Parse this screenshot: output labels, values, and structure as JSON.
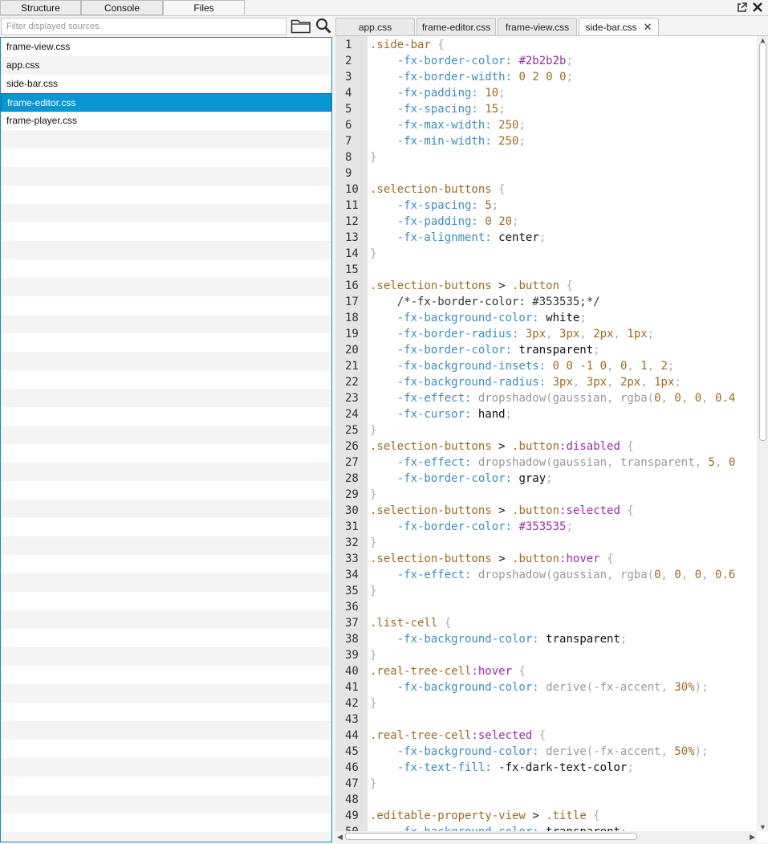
{
  "top_tabs": [
    {
      "label": "Structure",
      "active": false
    },
    {
      "label": "Console",
      "active": false
    },
    {
      "label": "Files",
      "active": true
    }
  ],
  "window_icons": [
    "external-link-icon",
    "close-icon"
  ],
  "filter": {
    "placeholder": "Filter displayed sources.",
    "value": ""
  },
  "file_list": [
    {
      "name": "frame-view.css",
      "selected": false
    },
    {
      "name": "app.css",
      "selected": false
    },
    {
      "name": "side-bar.css",
      "selected": false
    },
    {
      "name": "frame-editor.css",
      "selected": true
    },
    {
      "name": "frame-player.css",
      "selected": false
    }
  ],
  "editor_tabs": [
    {
      "label": "app.css",
      "active": false
    },
    {
      "label": "frame-editor.css",
      "active": false
    },
    {
      "label": "frame-view.css",
      "active": false
    },
    {
      "label": "side-bar.css",
      "active": true,
      "closable": true
    }
  ],
  "code_lines": [
    ".side-bar {",
    "    -fx-border-color: #2b2b2b;",
    "    -fx-border-width: 0 2 0 0;",
    "    -fx-padding: 10;",
    "    -fx-spacing: 15;",
    "    -fx-max-width: 250;",
    "    -fx-min-width: 250;",
    "}",
    "",
    ".selection-buttons {",
    "    -fx-spacing: 5;",
    "    -fx-padding: 0 20;",
    "    -fx-alignment: center;",
    "}",
    "",
    ".selection-buttons > .button {",
    "    /*-fx-border-color: #353535;*/",
    "    -fx-background-color: white;",
    "    -fx-border-radius: 3px, 3px, 2px, 1px;",
    "    -fx-border-color: transparent;",
    "    -fx-background-insets: 0 0 -1 0, 0, 1, 2;",
    "    -fx-background-radius: 3px, 3px, 2px, 1px;",
    "    -fx-effect: dropshadow(gaussian, rgba(0, 0, 0, 0.4",
    "    -fx-cursor: hand;",
    "}",
    ".selection-buttons > .button:disabled {",
    "    -fx-effect: dropshadow(gaussian, transparent, 5, 0",
    "    -fx-border-color: gray;",
    "}",
    ".selection-buttons > .button:selected {",
    "    -fx-border-color: #353535;",
    "}",
    ".selection-buttons > .button:hover {",
    "    -fx-effect: dropshadow(gaussian, rgba(0, 0, 0, 0.6",
    "}",
    "",
    ".list-cell {",
    "    -fx-background-color: transparent;",
    "}",
    ".real-tree-cell:hover {",
    "    -fx-background-color: derive(-fx-accent, 30%);",
    "}",
    "",
    ".real-tree-cell:selected {",
    "    -fx-background-color: derive(-fx-accent, 50%);",
    "    -fx-text-fill: -fx-dark-text-color;",
    "}",
    "",
    ".editable-property-view > .title {",
    "    -fx-background-color: transparent;"
  ],
  "colors": {
    "selection": "#0a96d4",
    "selector": "#a06a1e",
    "property": "#3a8fc0",
    "pseudo_class": "#9d2aa8"
  }
}
